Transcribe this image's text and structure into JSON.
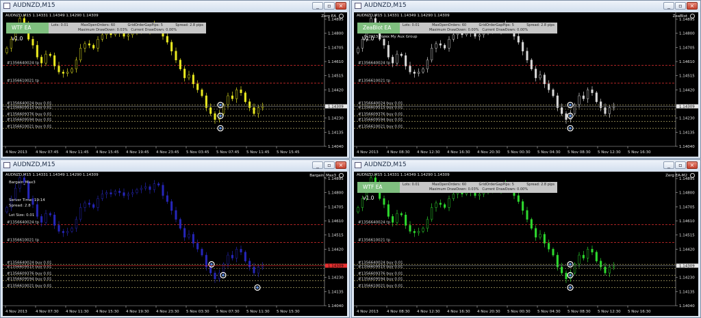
{
  "windows": [
    {
      "title": "AUDNZD,M15",
      "symbol_header": "AUDNZD,M15  1.14331 1.14349 1.14290 1.14309",
      "ea_corner": "Zerg EA",
      "panel": "wtf",
      "candle_color": "#e8e820",
      "trade_color": "#d8d8d8"
    },
    {
      "title": "AUDNZD,M15",
      "symbol_header": "AUDNZD,M15  1.14331 1.14349 1.14290 1.14309",
      "ea_corner": "ZeaBlot",
      "panel": "zea",
      "candle_color": "#d8d8d8",
      "trade_color": "#d8d8d8"
    },
    {
      "title": "AUDNZD,M15",
      "symbol_header": "AUDNZD,M15  1.14331 1.14349 1.14290 1.14309",
      "ea_corner": "Bargain_Max3",
      "panel": "bargain",
      "candle_color": "#2626b8",
      "trade_color": "#d8d8d8"
    },
    {
      "title": "AUDNZD,M15",
      "symbol_header": "AUDNZD,M15  1.14331 1.14349 1.14290 1.14309",
      "ea_corner": "Zerg EA-M2",
      "panel": "wtf",
      "candle_color": "#2ed82e",
      "trade_color": "#d8d8d8"
    }
  ],
  "price_axis": [
    "1.14895",
    "1.14800",
    "1.14705",
    "1.14610",
    "1.14515",
    "1.14420",
    "1.14309",
    "1.14230",
    "1.14135",
    "1.14040"
  ],
  "time_axis_top": [
    "4 Nov 2013",
    "4 Nov 07:45",
    "4 Nov 11:45",
    "4 Nov 15:45",
    "4 Nov 19:45",
    "4 Nov 23:45",
    "5 Nov 03:45",
    "5 Nov 07:45",
    "5 Nov 11:45",
    "5 Nov 15:45"
  ],
  "time_axis_right": [
    "4 Nov 2013",
    "4 Nov 08:30",
    "4 Nov 12:30",
    "4 Nov 16:30",
    "4 Nov 20:30",
    "5 Nov 00:30",
    "5 Nov 04:30",
    "5 Nov 08:30",
    "5 Nov 12:30",
    "5 Nov 16:30"
  ],
  "time_axis_bottom_left": [
    "4 Nov 2013",
    "4 Nov 07:30",
    "4 Nov 11:30",
    "4 Nov 15:30",
    "4 Nov 19:30",
    "4 Nov 23:30",
    "5 Nov 03:30",
    "5 Nov 07:30",
    "5 Nov 11:30",
    "5 Nov 15:30"
  ],
  "tp_lines": [
    {
      "label": "#1356640024 tp",
      "price": 1.14585
    },
    {
      "label": "#1356610021 tp",
      "price": 1.14465
    }
  ],
  "buy_lines": [
    {
      "label": "#1356640024 buy 0.01",
      "price": 1.14318
    },
    {
      "label": "#1356609515 buy 0.01",
      "price": 1.1429
    },
    {
      "label": "#1356609376 buy 0.01",
      "price": 1.14245
    },
    {
      "label": "#1356609594 buy 0.01",
      "price": 1.14208
    },
    {
      "label": "#1356610021 buy 0.01",
      "price": 1.14162
    }
  ],
  "current_price": "1.14309",
  "panel_wtf": {
    "name": "WTF EA v1.0",
    "lots": "Lots: 0.01",
    "max_open": "MaxOpenOrders: 60",
    "grid_gap": "GridOrderGapPips: 5",
    "spread": "Spread: 2.8 pips",
    "max_dd": "Maximum DrawDown: 0.03%",
    "cur_dd": "Current DrawDown: 0.00%"
  },
  "panel_zea": {
    "name": "ZeaBlot EA v1.0",
    "lots": "Lots: 0.01",
    "max_open": "MaxOpenOrders: 60",
    "grid_gap": "GridOrderGapPips: 5",
    "spread": "Spread: 2.8 pips",
    "max_dd": "Maximum DrawDown: 0.00%",
    "cur_dd": "Current DrawDown: 0.00%",
    "copyright": "© 2013 Forex My Aux Group"
  },
  "panel_bargain": {
    "name": "Bargain_Max3",
    "server_time": "Server Time: 19:14",
    "spread": "Spread: 2.8",
    "lot_size": "Lot Size: 0.01"
  },
  "colors": {
    "tp_line": "#c42a2a",
    "buy_line": "#d0c47a",
    "panel_green": "#7fbf7f",
    "current_flag": "#e8e8e8",
    "bid_red": "#e83030"
  },
  "chart_data": {
    "type": "candlestick",
    "symbol": "AUDNZD",
    "timeframe": "M15",
    "ylim": [
      1.1404,
      1.14895
    ],
    "close_series": [
      1.147,
      1.1476,
      1.1483,
      1.149,
      1.1487,
      1.1476,
      1.1472,
      1.1464,
      1.146,
      1.1466,
      1.1465,
      1.1458,
      1.1454,
      1.1453,
      1.1454,
      1.1456,
      1.1462,
      1.147,
      1.1473,
      1.1472,
      1.147,
      1.1476,
      1.1479,
      1.148,
      1.1479,
      1.1481,
      1.148,
      1.1478,
      1.1479,
      1.148,
      1.1482,
      1.1483,
      1.1484,
      1.1482,
      1.1486,
      1.1485,
      1.1478,
      1.1474,
      1.1468,
      1.1462,
      1.1456,
      1.145,
      1.1452,
      1.1446,
      1.1442,
      1.1438,
      1.143,
      1.1426,
      1.1422,
      1.1426,
      1.1432,
      1.1438,
      1.1436,
      1.1442,
      1.144,
      1.1434,
      1.143,
      1.1426,
      1.143,
      1.14309
    ]
  }
}
